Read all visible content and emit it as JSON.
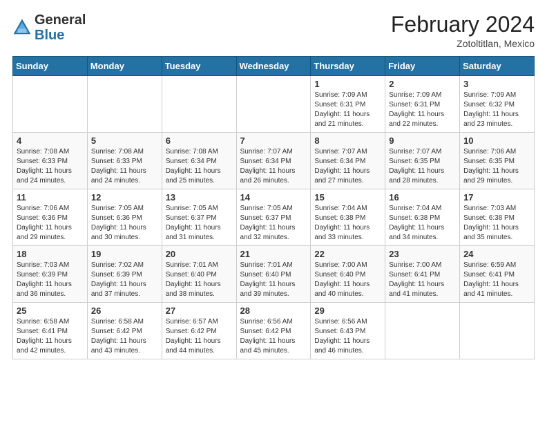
{
  "header": {
    "logo_general": "General",
    "logo_blue": "Blue",
    "month": "February 2024",
    "location": "Zotoltitlan, Mexico"
  },
  "days_of_week": [
    "Sunday",
    "Monday",
    "Tuesday",
    "Wednesday",
    "Thursday",
    "Friday",
    "Saturday"
  ],
  "weeks": [
    [
      {
        "day": "",
        "info": ""
      },
      {
        "day": "",
        "info": ""
      },
      {
        "day": "",
        "info": ""
      },
      {
        "day": "",
        "info": ""
      },
      {
        "day": "1",
        "info": "Sunrise: 7:09 AM\nSunset: 6:31 PM\nDaylight: 11 hours\nand 21 minutes."
      },
      {
        "day": "2",
        "info": "Sunrise: 7:09 AM\nSunset: 6:31 PM\nDaylight: 11 hours\nand 22 minutes."
      },
      {
        "day": "3",
        "info": "Sunrise: 7:09 AM\nSunset: 6:32 PM\nDaylight: 11 hours\nand 23 minutes."
      }
    ],
    [
      {
        "day": "4",
        "info": "Sunrise: 7:08 AM\nSunset: 6:33 PM\nDaylight: 11 hours\nand 24 minutes."
      },
      {
        "day": "5",
        "info": "Sunrise: 7:08 AM\nSunset: 6:33 PM\nDaylight: 11 hours\nand 24 minutes."
      },
      {
        "day": "6",
        "info": "Sunrise: 7:08 AM\nSunset: 6:34 PM\nDaylight: 11 hours\nand 25 minutes."
      },
      {
        "day": "7",
        "info": "Sunrise: 7:07 AM\nSunset: 6:34 PM\nDaylight: 11 hours\nand 26 minutes."
      },
      {
        "day": "8",
        "info": "Sunrise: 7:07 AM\nSunset: 6:34 PM\nDaylight: 11 hours\nand 27 minutes."
      },
      {
        "day": "9",
        "info": "Sunrise: 7:07 AM\nSunset: 6:35 PM\nDaylight: 11 hours\nand 28 minutes."
      },
      {
        "day": "10",
        "info": "Sunrise: 7:06 AM\nSunset: 6:35 PM\nDaylight: 11 hours\nand 29 minutes."
      }
    ],
    [
      {
        "day": "11",
        "info": "Sunrise: 7:06 AM\nSunset: 6:36 PM\nDaylight: 11 hours\nand 29 minutes."
      },
      {
        "day": "12",
        "info": "Sunrise: 7:05 AM\nSunset: 6:36 PM\nDaylight: 11 hours\nand 30 minutes."
      },
      {
        "day": "13",
        "info": "Sunrise: 7:05 AM\nSunset: 6:37 PM\nDaylight: 11 hours\nand 31 minutes."
      },
      {
        "day": "14",
        "info": "Sunrise: 7:05 AM\nSunset: 6:37 PM\nDaylight: 11 hours\nand 32 minutes."
      },
      {
        "day": "15",
        "info": "Sunrise: 7:04 AM\nSunset: 6:38 PM\nDaylight: 11 hours\nand 33 minutes."
      },
      {
        "day": "16",
        "info": "Sunrise: 7:04 AM\nSunset: 6:38 PM\nDaylight: 11 hours\nand 34 minutes."
      },
      {
        "day": "17",
        "info": "Sunrise: 7:03 AM\nSunset: 6:38 PM\nDaylight: 11 hours\nand 35 minutes."
      }
    ],
    [
      {
        "day": "18",
        "info": "Sunrise: 7:03 AM\nSunset: 6:39 PM\nDaylight: 11 hours\nand 36 minutes."
      },
      {
        "day": "19",
        "info": "Sunrise: 7:02 AM\nSunset: 6:39 PM\nDaylight: 11 hours\nand 37 minutes."
      },
      {
        "day": "20",
        "info": "Sunrise: 7:01 AM\nSunset: 6:40 PM\nDaylight: 11 hours\nand 38 minutes."
      },
      {
        "day": "21",
        "info": "Sunrise: 7:01 AM\nSunset: 6:40 PM\nDaylight: 11 hours\nand 39 minutes."
      },
      {
        "day": "22",
        "info": "Sunrise: 7:00 AM\nSunset: 6:40 PM\nDaylight: 11 hours\nand 40 minutes."
      },
      {
        "day": "23",
        "info": "Sunrise: 7:00 AM\nSunset: 6:41 PM\nDaylight: 11 hours\nand 41 minutes."
      },
      {
        "day": "24",
        "info": "Sunrise: 6:59 AM\nSunset: 6:41 PM\nDaylight: 11 hours\nand 41 minutes."
      }
    ],
    [
      {
        "day": "25",
        "info": "Sunrise: 6:58 AM\nSunset: 6:41 PM\nDaylight: 11 hours\nand 42 minutes."
      },
      {
        "day": "26",
        "info": "Sunrise: 6:58 AM\nSunset: 6:42 PM\nDaylight: 11 hours\nand 43 minutes."
      },
      {
        "day": "27",
        "info": "Sunrise: 6:57 AM\nSunset: 6:42 PM\nDaylight: 11 hours\nand 44 minutes."
      },
      {
        "day": "28",
        "info": "Sunrise: 6:56 AM\nSunset: 6:42 PM\nDaylight: 11 hours\nand 45 minutes."
      },
      {
        "day": "29",
        "info": "Sunrise: 6:56 AM\nSunset: 6:43 PM\nDaylight: 11 hours\nand 46 minutes."
      },
      {
        "day": "",
        "info": ""
      },
      {
        "day": "",
        "info": ""
      }
    ]
  ]
}
